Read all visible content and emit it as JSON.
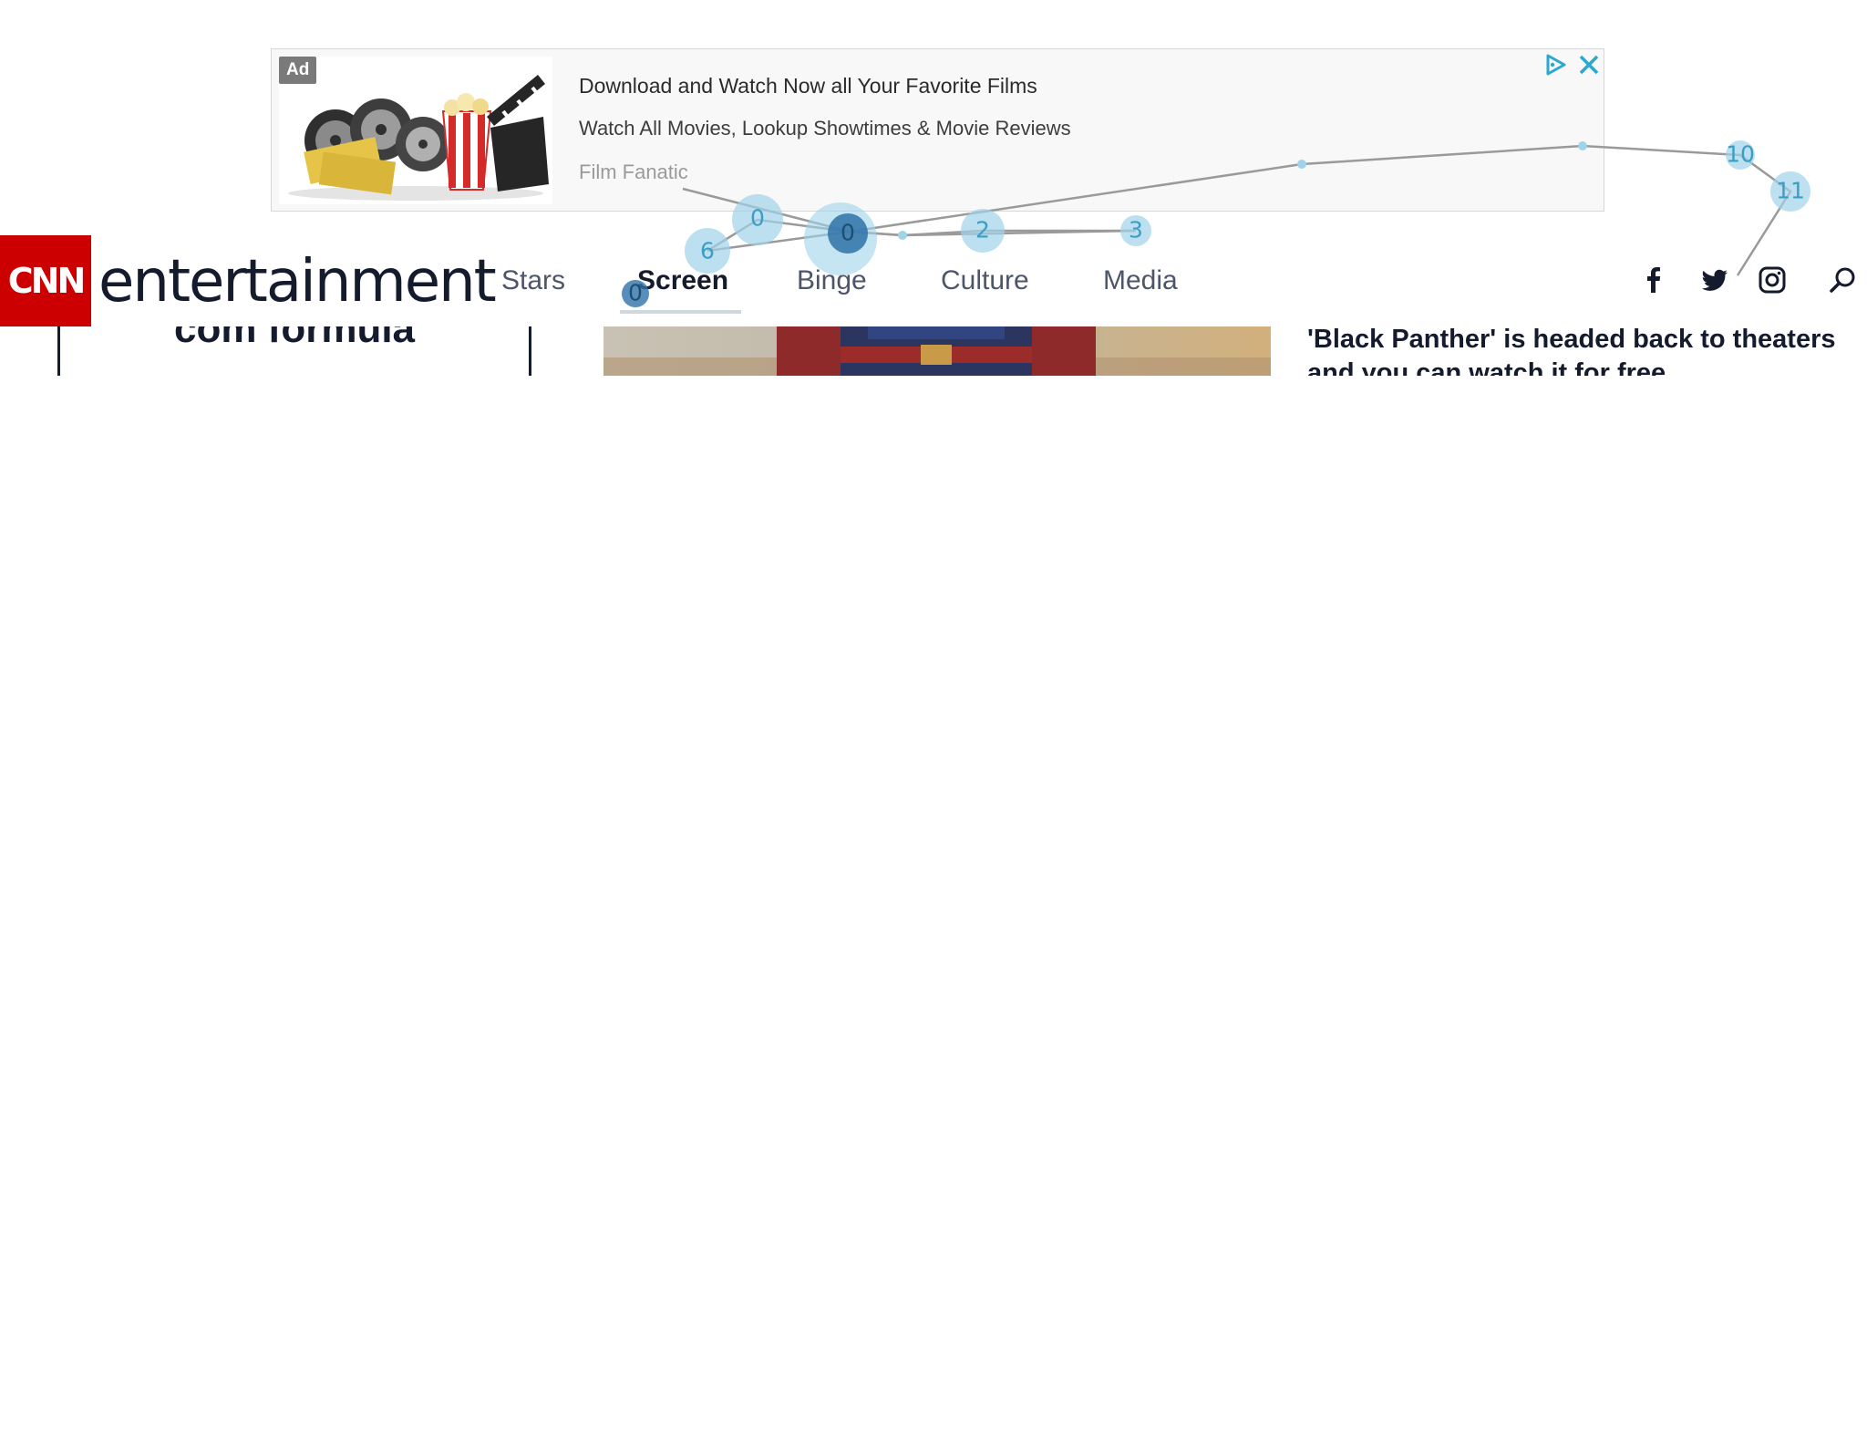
{
  "ad": {
    "badge": "Ad",
    "headline": "Download and Watch Now all Your Favorite Films",
    "description": "Watch All Movies, Lookup Showtimes & Movie Reviews",
    "source": "Film Fanatic",
    "image_icon": "film-reels-popcorn-clapboard-image",
    "icons": [
      "adchoices-icon",
      "close-icon"
    ]
  },
  "header": {
    "logo": "CNN",
    "brand": "entertainment",
    "logo_color": "#cc0000",
    "nav": [
      {
        "label": "Stars"
      },
      {
        "label": "Screen",
        "active": true
      },
      {
        "label": "Binge"
      },
      {
        "label": "Culture"
      },
      {
        "label": "Media"
      }
    ],
    "social_icons": [
      "facebook-icon",
      "twitter-icon",
      "instagram-icon",
      "search-icon"
    ]
  },
  "content": {
    "left_headline": "com formula",
    "right_headline": "'Black Panther' is headed back to theaters and you can watch it for free"
  },
  "gaze_overlay": {
    "fixation_labels": [
      "0",
      "6",
      "0",
      "2",
      "3",
      "10",
      "11",
      "0"
    ],
    "colors": {
      "fixation": "#9fd3ea",
      "fixation_active": "#2e72a8",
      "path": "#9a9a9a"
    }
  }
}
